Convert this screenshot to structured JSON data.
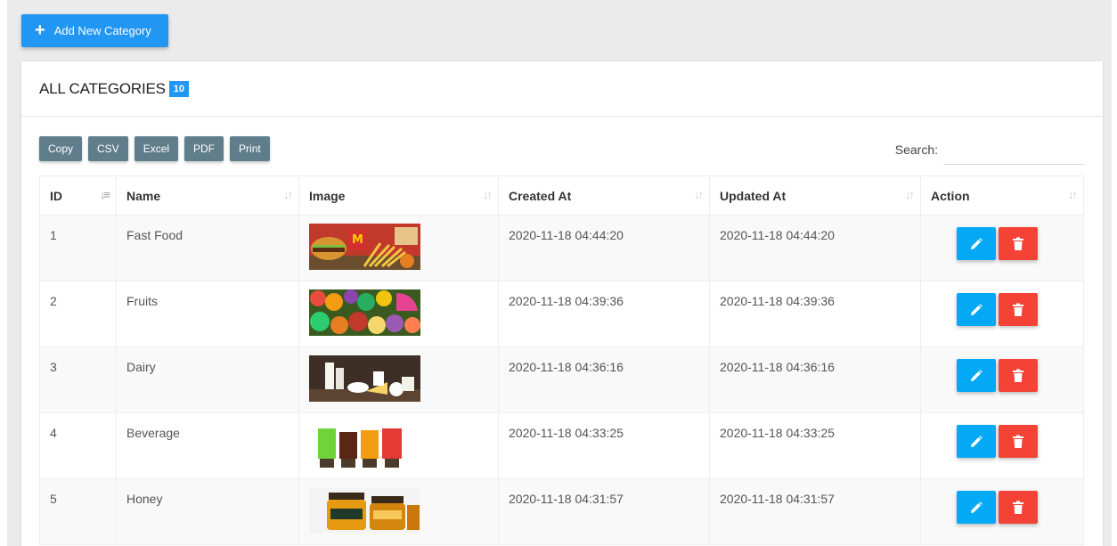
{
  "add_button": {
    "label": "Add New Category"
  },
  "card": {
    "title": "ALL CATEGORIES",
    "count": "10"
  },
  "toolbar": {
    "buttons": [
      "Copy",
      "CSV",
      "Excel",
      "PDF",
      "Print"
    ]
  },
  "search": {
    "label": "Search:",
    "value": "",
    "placeholder": ""
  },
  "table": {
    "columns": [
      "ID",
      "Name",
      "Image",
      "Created At",
      "Updated At",
      "Action"
    ],
    "rows": [
      {
        "id": "1",
        "name": "Fast Food",
        "image": "fast-food-thumbnail",
        "created": "2020-11-18 04:44:20",
        "updated": "2020-11-18 04:44:20"
      },
      {
        "id": "2",
        "name": "Fruits",
        "image": "fruits-thumbnail",
        "created": "2020-11-18 04:39:36",
        "updated": "2020-11-18 04:39:36"
      },
      {
        "id": "3",
        "name": "Dairy",
        "image": "dairy-thumbnail",
        "created": "2020-11-18 04:36:16",
        "updated": "2020-11-18 04:36:16"
      },
      {
        "id": "4",
        "name": "Beverage",
        "image": "beverage-thumbnail",
        "created": "2020-11-18 04:33:25",
        "updated": "2020-11-18 04:33:25"
      },
      {
        "id": "5",
        "name": "Honey",
        "image": "honey-thumbnail",
        "created": "2020-11-18 04:31:57",
        "updated": "2020-11-18 04:31:57"
      }
    ]
  },
  "colors": {
    "primary": "#2196f3",
    "toolbar_button": "#607d8b",
    "edit": "#03a9f4",
    "delete": "#f44336",
    "page_background": "#ebebeb"
  },
  "icons": {
    "add": "plus-icon",
    "sort": "sort-icon",
    "sort_active": "sort-ascending-icon",
    "edit": "pencil-icon",
    "delete": "trash-icon"
  }
}
